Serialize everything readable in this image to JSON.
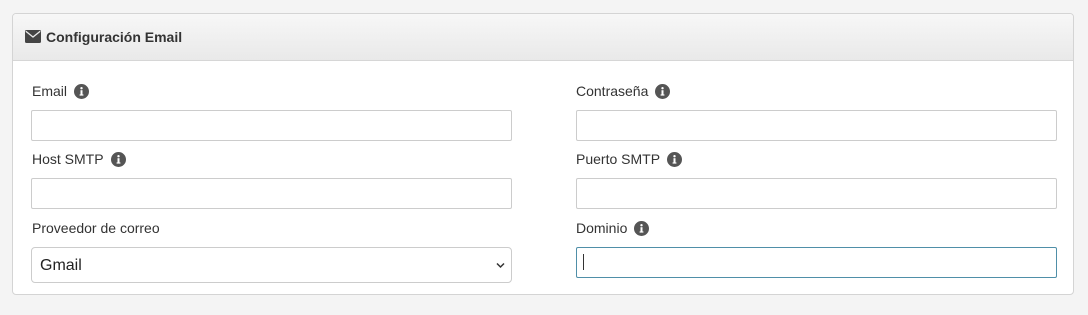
{
  "panel": {
    "title": "Configuración Email",
    "icon": "envelope-icon"
  },
  "fields": {
    "email": {
      "label": "Email",
      "value": "",
      "info_icon": "info-icon"
    },
    "password": {
      "label": "Contraseña",
      "value": "",
      "info_icon": "info-icon"
    },
    "smtp_host": {
      "label": "Host SMTP",
      "value": "",
      "info_icon": "info-icon"
    },
    "smtp_port": {
      "label": "Puerto SMTP",
      "value": "",
      "info_icon": "info-icon"
    },
    "provider": {
      "label": "Proveedor de correo",
      "selected": "Gmail"
    },
    "domain": {
      "label": "Dominio",
      "value": "",
      "info_icon": "info-icon",
      "focused": true
    }
  },
  "colors": {
    "focus_border": "#4f8fa8",
    "info_icon": "#555555"
  }
}
